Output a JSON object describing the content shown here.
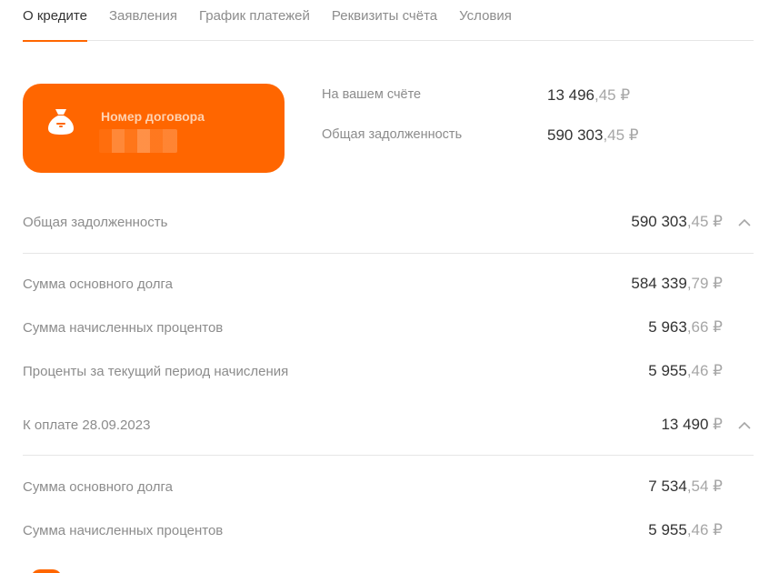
{
  "tabs": [
    {
      "label": "О кредите",
      "active": true
    },
    {
      "label": "Заявления",
      "active": false
    },
    {
      "label": "График платежей",
      "active": false
    },
    {
      "label": "Реквизиты счёта",
      "active": false
    },
    {
      "label": "Условия",
      "active": false
    }
  ],
  "card": {
    "icon": "money-bag-icon",
    "contract_label": "Номер договора",
    "color": "#ff6600"
  },
  "summary": {
    "account": {
      "label": "На вашем счёте",
      "int": "13 496",
      "frac": ",45 ₽"
    },
    "debt": {
      "label": "Общая задолженность",
      "int": "590 303",
      "frac": ",45 ₽"
    }
  },
  "total_debt": {
    "label": "Общая задолженность",
    "int": "590 303",
    "frac": ",45 ₽",
    "items": [
      {
        "label": "Сумма основного долга",
        "int": "584 339",
        "frac": ",79 ₽"
      },
      {
        "label": "Сумма начисленных процентов",
        "int": "5 963",
        "frac": ",66 ₽"
      },
      {
        "label": "Проценты за текущий период начисления",
        "int": "5 955",
        "frac": ",46 ₽"
      }
    ]
  },
  "payment_due": {
    "label": "К оплате 28.09.2023",
    "int": "13 490",
    "frac": " ₽",
    "items": [
      {
        "label": "Сумма основного долга",
        "int": "7 534",
        "frac": ",54 ₽"
      },
      {
        "label": "Сумма начисленных процентов",
        "int": "5 955",
        "frac": ",46 ₽"
      }
    ]
  },
  "colors": {
    "accent": "#ff6600",
    "text": "#333333",
    "muted": "#8c8c8c",
    "divider": "#e6e6e6"
  }
}
